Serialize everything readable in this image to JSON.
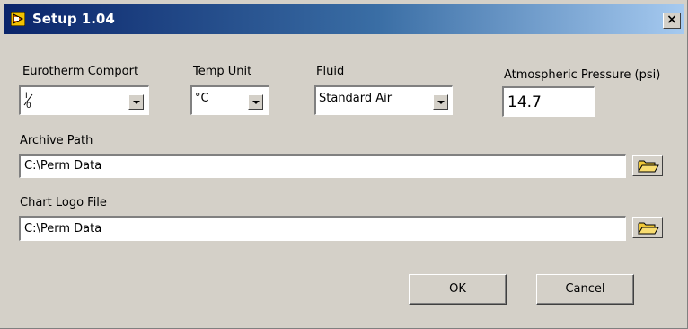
{
  "window": {
    "title": "Setup  1.04",
    "close_label": "×"
  },
  "fields": {
    "comport": {
      "label": "Eurotherm Comport",
      "value": ""
    },
    "temp_unit": {
      "label": "Temp Unit",
      "value": "°C"
    },
    "fluid": {
      "label": "Fluid",
      "value": "Standard Air"
    },
    "pressure": {
      "label": "Atmospheric Pressure (psi)",
      "value": "14.7"
    },
    "archive_path": {
      "label": "Archive Path",
      "value": "C:\\Perm Data"
    },
    "logo_file": {
      "label": "Chart Logo File",
      "value": "C:\\Perm Data"
    }
  },
  "buttons": {
    "ok": "OK",
    "cancel": "Cancel"
  },
  "icons": {
    "app": "labview-app-icon",
    "io": "io-resource-icon",
    "dropdown": "chevron-down-icon",
    "browse": "folder-open-icon"
  },
  "colors": {
    "title_start": "#0a246a",
    "title_end": "#a6caf0",
    "face": "#d4d0c8",
    "folder": "#f0c838"
  }
}
